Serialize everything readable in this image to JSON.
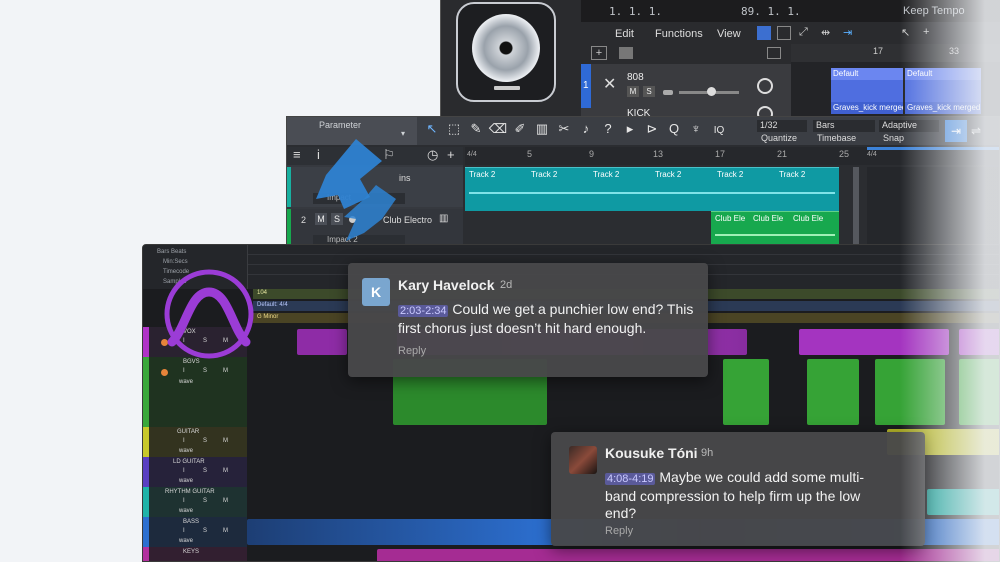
{
  "logic": {
    "lcd_position": "1. 1. 1.",
    "lcd_position2": "89. 1. 1.",
    "keep_tempo": "Keep Tempo",
    "menu": [
      "Edit",
      "Functions",
      "View"
    ],
    "ruler_marks": [
      "17",
      "33"
    ],
    "tracks": [
      {
        "number": "1",
        "name": "808",
        "mute": "M",
        "solo": "S"
      },
      {
        "number": "",
        "name": "KICK",
        "mute": "",
        "solo": ""
      }
    ],
    "regions": [
      {
        "label": "Default"
      },
      {
        "label": "Default"
      },
      {
        "label": "Graves_kick merged"
      },
      {
        "label": "Graves_kick merged"
      }
    ]
  },
  "studio_one": {
    "parameter_label": "Parameter",
    "quantize_value": "1/32",
    "quantize_label": "Quantize",
    "timebase_value": "Bars",
    "timebase_label": "Timebase",
    "snap_value": "Adaptive",
    "snap_label": "Snap",
    "ruler_marks": [
      "5",
      "9",
      "13",
      "17",
      "21",
      "25"
    ],
    "ruler_start": "4/4",
    "ruler_start2": "4/4",
    "tracks": [
      {
        "number": "",
        "name": "ins",
        "instrument": "Impact"
      },
      {
        "number": "2",
        "mute": "M",
        "solo": "S",
        "name": "Club Electro",
        "instrument": "Impact 2"
      }
    ],
    "region_label": "Track 2",
    "club_region_label": "Club Ele"
  },
  "protools": {
    "ruler_rows": [
      "Bars Beats",
      "Min:Secs",
      "Timecode",
      "Samples"
    ],
    "markers": [
      "104",
      "Default: 4/4",
      "G Minor"
    ],
    "tracks": [
      {
        "name": "VOX",
        "color": "#b033c7"
      },
      {
        "name": "BGVS",
        "color": "#3aa83a"
      },
      {
        "name": "GUITAR",
        "color": "#c8c82a"
      },
      {
        "name": "LD GUITAR",
        "color": "#5a3fc2"
      },
      {
        "name": "RHYTHM GUITAR",
        "color": "#1fb3a8"
      },
      {
        "name": "BASS",
        "color": "#2c6fd0"
      },
      {
        "name": "KEYS",
        "color": "#b2309e"
      }
    ],
    "btn_i": "I",
    "btn_s": "S",
    "btn_m": "M",
    "wave_label": "wave"
  },
  "comments": [
    {
      "author": "Kary Havelock",
      "avatar_initial": "K",
      "time": "2d",
      "range": "2:03-2:34",
      "body": "Could we get a punchier low end? This first chorus just doesn’t hit hard enough.",
      "reply": "Reply"
    },
    {
      "author": "Kousuke Tóni",
      "time": "9h",
      "range": "4:08-4:19",
      "body": "Maybe we could add some multi-band compression to help firm up the low end?",
      "reply": "Reply"
    }
  ]
}
